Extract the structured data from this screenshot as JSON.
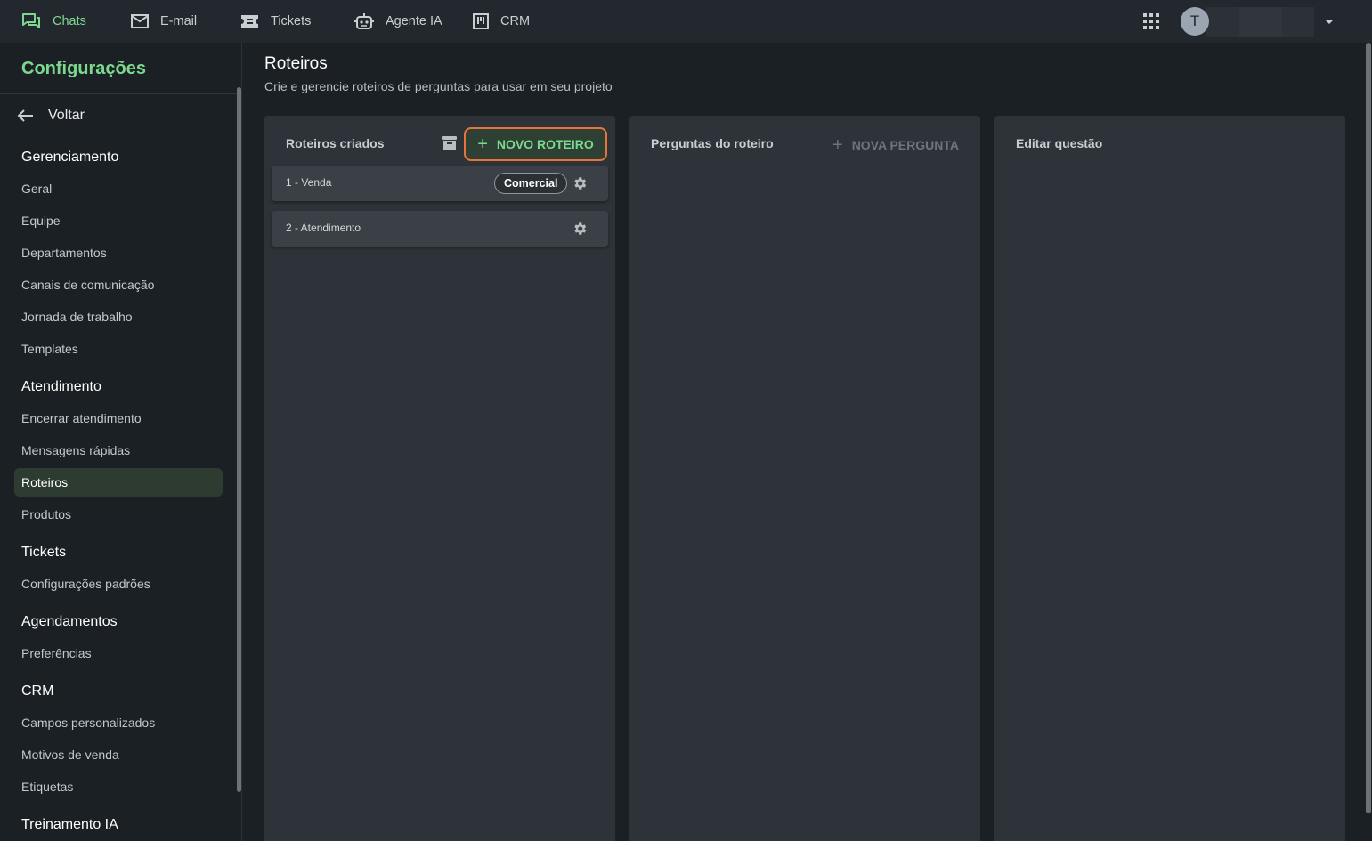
{
  "topnav": {
    "items": [
      {
        "label": "Chats",
        "icon": "chat-icon",
        "active": true
      },
      {
        "label": "E-mail",
        "icon": "mail-icon"
      },
      {
        "label": "Tickets",
        "icon": "ticket-icon"
      },
      {
        "label": "Agente IA",
        "icon": "robot-icon"
      },
      {
        "label": "CRM",
        "icon": "kanban-icon"
      }
    ],
    "avatar_initial": "T"
  },
  "sidebar": {
    "title": "Configurações",
    "back_label": "Voltar",
    "sections": [
      {
        "title": "Gerenciamento",
        "items": [
          "Geral",
          "Equipe",
          "Departamentos",
          "Canais de comunicação",
          "Jornada de trabalho",
          "Templates"
        ]
      },
      {
        "title": "Atendimento",
        "items": [
          "Encerrar atendimento",
          "Mensagens rápidas",
          "Roteiros",
          "Produtos"
        ]
      },
      {
        "title": "Tickets",
        "items": [
          "Configurações padrões"
        ]
      },
      {
        "title": "Agendamentos",
        "items": [
          "Preferências"
        ]
      },
      {
        "title": "CRM",
        "items": [
          "Campos personalizados",
          "Motivos de venda",
          "Etiquetas"
        ]
      },
      {
        "title": "Treinamento IA",
        "items": []
      }
    ],
    "active_item": "Roteiros"
  },
  "main": {
    "title": "Roteiros",
    "subtitle": "Crie e gerencie roteiros de perguntas para usar em seu projeto",
    "panels": {
      "roteiros": {
        "title": "Roteiros criados",
        "new_button": "NOVO ROTEIRO",
        "items": [
          {
            "label": "1 - Venda",
            "tag": "Comercial"
          },
          {
            "label": "2 - Atendimento",
            "tag": ""
          }
        ]
      },
      "perguntas": {
        "title": "Perguntas do roteiro",
        "new_button": "NOVA PERGUNTA"
      },
      "editar": {
        "title": "Editar questão"
      }
    }
  },
  "colors": {
    "accent": "#7dd88f",
    "highlight_border": "#e8743b",
    "panel": "#2d3338",
    "background": "#1b2024"
  }
}
